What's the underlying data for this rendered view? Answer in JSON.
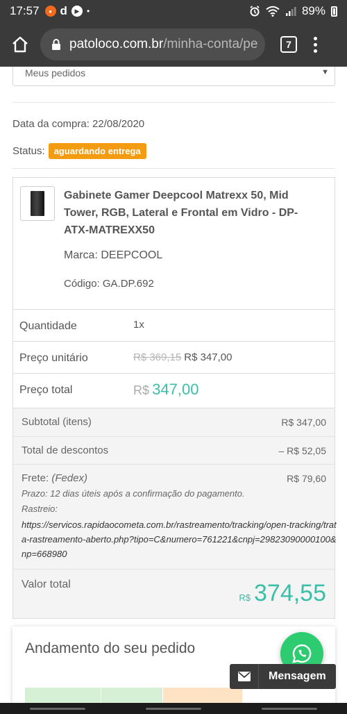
{
  "statusbar": {
    "time": "17:57",
    "battery": "89%"
  },
  "browser": {
    "url_host": "patoloco.com.br",
    "url_path": "/minha-conta/pe",
    "tab_count": "7"
  },
  "order_select": {
    "value": "Meus pedidos"
  },
  "purchase": {
    "date_text": "Data da compra: 22/08/2020",
    "status_label": "Status:",
    "status_badge": "aguardando entrega"
  },
  "product": {
    "name": "Gabinete Gamer Deepcool Matrexx 50, Mid Tower, RGB, Lateral e Frontal em Vidro - DP-ATX-MATREXX50",
    "brand": "Marca: DEEPCOOL",
    "code": "Código: GA.DP.692"
  },
  "details": {
    "qty_label": "Quantidade",
    "qty_value": "1x",
    "unit_label": "Preço unitário",
    "unit_old": "R$ 369,15",
    "unit_new": "R$ 347,00",
    "total_label": "Preço total",
    "total_currency": "R$",
    "total_value": "347,00"
  },
  "summary": {
    "subtotal_label": "Subtotal (itens)",
    "subtotal_value": "R$ 347,00",
    "discount_label": "Total de descontos",
    "discount_value": "– R$ 52,05",
    "freight_label": "Frete:",
    "freight_carrier": "(Fedex)",
    "freight_value": "R$ 79,60",
    "deadline": "Prazo: 12 dias úteis após a confirmação do pagamento.",
    "tracking_label": "Rastreio:",
    "tracking_url": "https://servicos.rapidaocometa.com.br/rastreamento/tracking/open-tracking/trata-rastreamento-aberto.php?tipo=C&numero=761221&cnpj=29823090000100&np=668980",
    "grand_label": "Valor total",
    "grand_currency": "R$",
    "grand_value": "374,55"
  },
  "progress": {
    "title": "Andamento do seu pedido"
  },
  "chat": {
    "message_label": "Mensagem"
  },
  "colors": {
    "accent_green": "#3bbfa6",
    "status_orange": "#f39c12",
    "whatsapp_green": "#2ecc71",
    "step_colors": [
      "#d5f0d5",
      "#d5f0d5",
      "#fde3c4",
      "#ffffff"
    ]
  }
}
